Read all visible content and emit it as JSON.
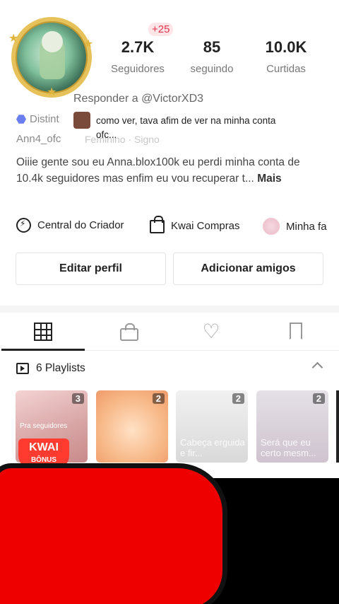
{
  "profile": {
    "new_followers_badge": "+25",
    "stats": [
      {
        "value": "2.7K",
        "label": "Seguidores"
      },
      {
        "value": "85",
        "label": "seguindo"
      },
      {
        "value": "10.0K",
        "label": "Curtidas"
      }
    ],
    "badge_label": "Distint",
    "handle": "Ann4_ofc",
    "handle_extra": "Feminino · Signo",
    "bio": "Oiiie gente sou eu Anna.blox100k eu perdi minha conta de 10.4k seguidores mas enfim eu vou recuperar t...",
    "bio_more": "Mais"
  },
  "reply_overlay": {
    "title": "Responder a @VictorXD3",
    "comment": "como ver, tava afim de ver na minha conta ofc..."
  },
  "links": [
    {
      "label": "Central do Criador",
      "icon": "creator-center-icon"
    },
    {
      "label": "Kwai Compras",
      "icon": "shopping-bag-icon"
    },
    {
      "label": "Minha fa",
      "icon": "fan-club-icon"
    }
  ],
  "buttons": {
    "edit_profile": "Editar perfil",
    "add_friends": "Adicionar amigos"
  },
  "tabs": [
    "grid-icon",
    "lock-icon",
    "heart-icon",
    "bookmark-icon"
  ],
  "playlists": {
    "header": "6 Playlists",
    "items": [
      {
        "count": "3",
        "caption": "Pra seguidores"
      },
      {
        "count": "2",
        "caption": ""
      },
      {
        "count": "2",
        "caption": "Cabeça erguida e fir..."
      },
      {
        "count": "2",
        "caption": "Será que eu certo mesm..."
      }
    ],
    "promo": {
      "title": "KWAI",
      "subtitle": "BÔNUS"
    }
  }
}
